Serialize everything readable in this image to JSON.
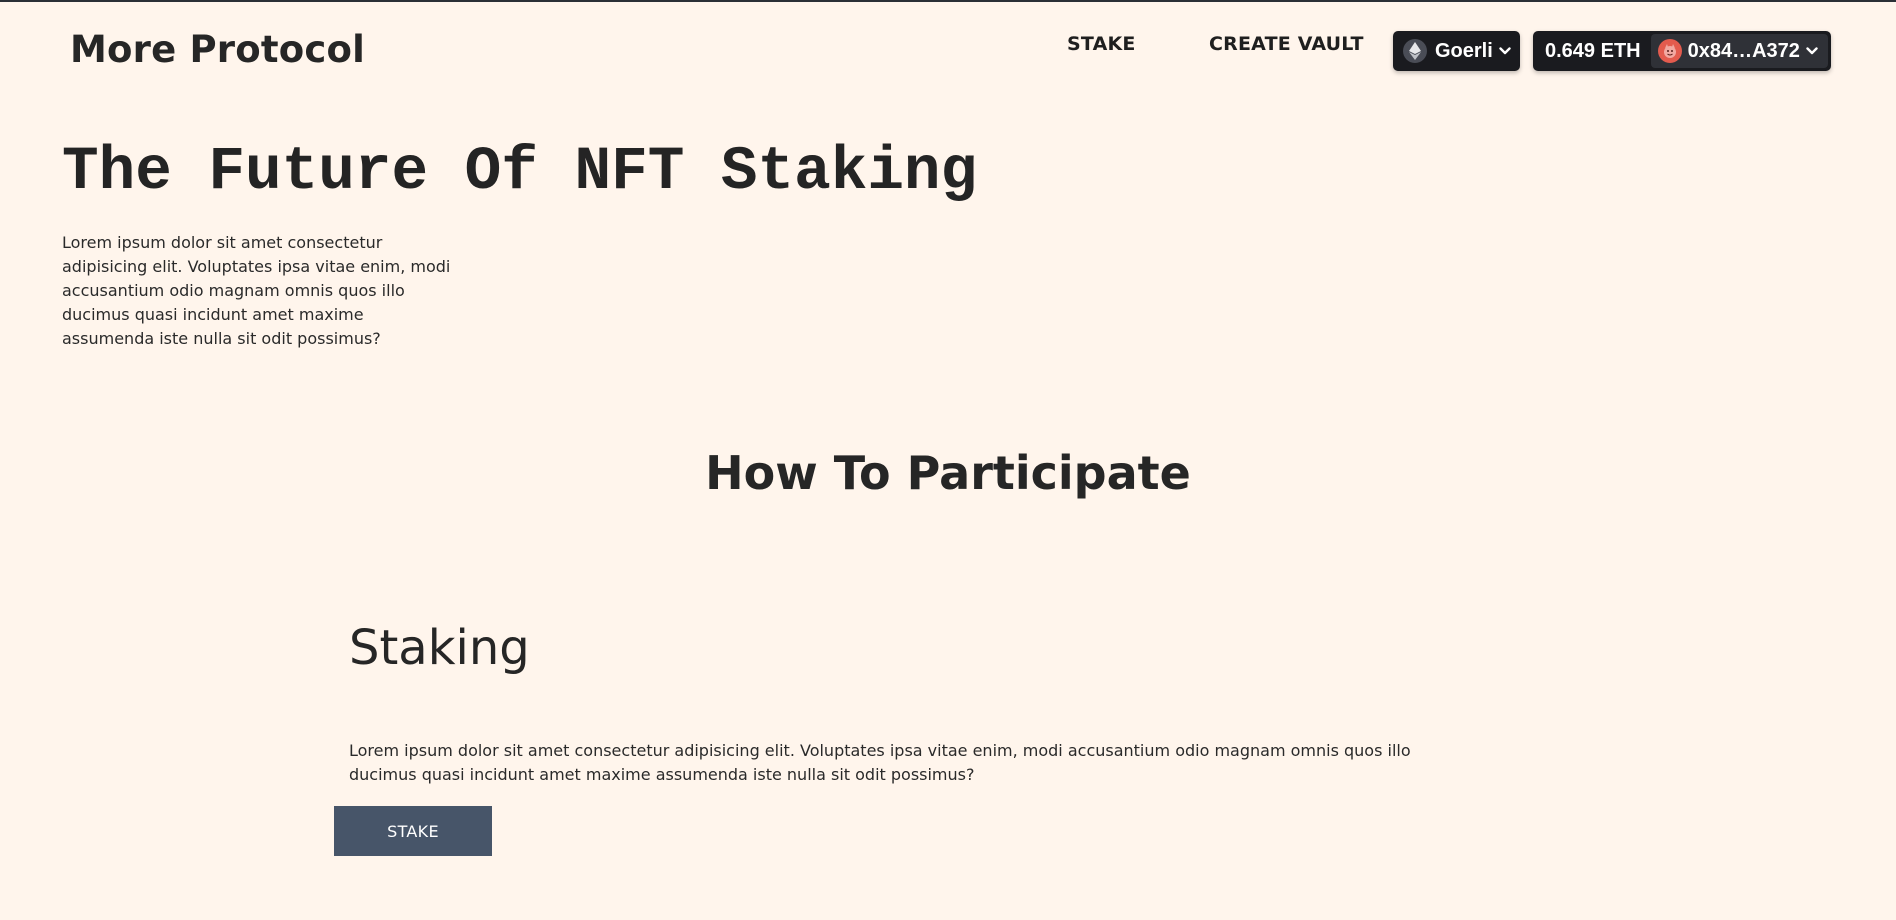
{
  "header": {
    "logo": "More Protocol",
    "nav": [
      {
        "label": "STAKE"
      },
      {
        "label": "CREATE VAULT"
      }
    ],
    "wallet": {
      "chain_name": "Goerli",
      "chain_icon": "ethereum-icon",
      "balance": "0.649 ETH",
      "address": "0x84…A372",
      "avatar_icon": "avatar-emoji-icon"
    }
  },
  "hero": {
    "title": "The Future Of NFT Staking",
    "text": "Lorem ipsum dolor sit amet consectetur adipisicing elit. Voluptates ipsa vitae enim, modi accusantium odio magnam omnis quos illo ducimus quasi incidunt amet maxime assumenda iste nulla sit odit possimus?"
  },
  "participate": {
    "title": "How To Participate",
    "card": {
      "title": "Staking",
      "text": "Lorem ipsum dolor sit amet consectetur adipisicing elit. Voluptates ipsa vitae enim, modi accusantium odio magnam omnis quos illo ducimus quasi incidunt amet maxime assumenda iste nulla sit odit possimus?",
      "button_label": "STAKE"
    }
  },
  "colors": {
    "background": "#fff5ec",
    "wallet_button": "#1a1b1f",
    "cta_button": "#475569",
    "avatar": "#e35b4e"
  }
}
